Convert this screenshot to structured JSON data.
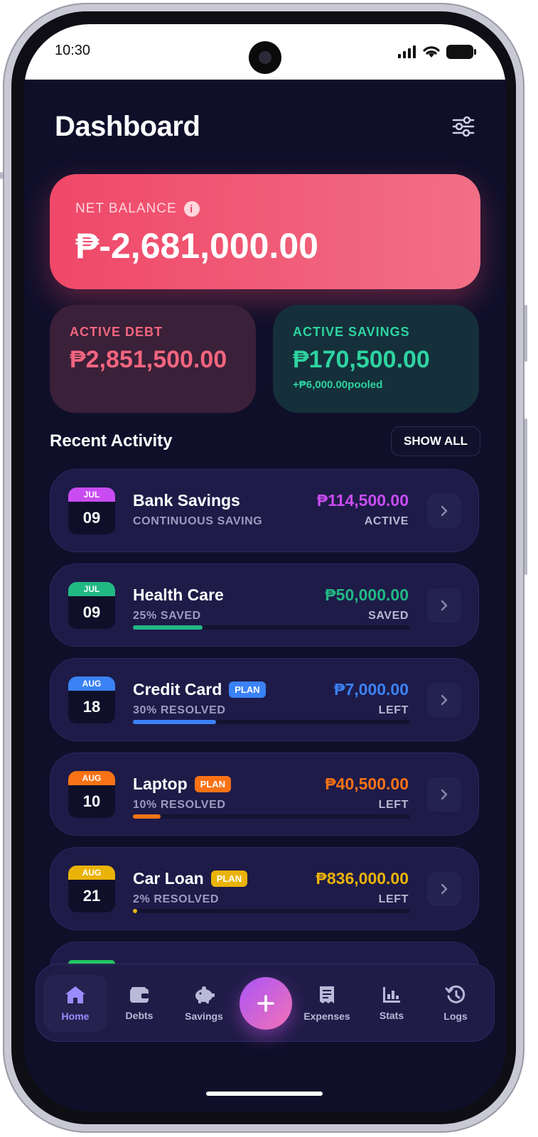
{
  "status_bar": {
    "time": "10:30"
  },
  "header": {
    "title": "Dashboard",
    "filter_icon": "sliders-icon"
  },
  "net_balance": {
    "label": "NET BALANCE",
    "value": "₱-2,681,000.00",
    "color": "#ef4868"
  },
  "summary": {
    "debt": {
      "label": "ACTIVE DEBT",
      "value": "₱2,851,500.00",
      "color": "#f2657f"
    },
    "savings": {
      "label": "ACTIVE SAVINGS",
      "value": "₱170,500.00",
      "sub": "+₱6,000.00pooled",
      "color": "#2ed3a0"
    }
  },
  "recent_activity": {
    "title": "Recent Activity",
    "show_all_label": "SHOW ALL",
    "items": [
      {
        "month": "JUL",
        "day": "09",
        "name": "Bank Savings",
        "badge": "",
        "subtitle": "CONTINUOUS SAVING",
        "amount": "₱114,500.00",
        "status": "ACTIVE",
        "color": "#c94cf2",
        "progress": null
      },
      {
        "month": "JUL",
        "day": "09",
        "name": "Health Care",
        "badge": "",
        "subtitle": "25% SAVED",
        "amount": "₱50,000.00",
        "status": "SAVED",
        "color": "#22b884",
        "progress": 0.25
      },
      {
        "month": "AUG",
        "day": "18",
        "name": "Credit Card",
        "badge": "PLAN",
        "subtitle": "30% RESOLVED",
        "amount": "₱7,000.00",
        "status": "LEFT",
        "color": "#3b82f6",
        "progress": 0.3
      },
      {
        "month": "AUG",
        "day": "10",
        "name": "Laptop",
        "badge": "PLAN",
        "subtitle": "10% RESOLVED",
        "amount": "₱40,500.00",
        "status": "LEFT",
        "color": "#f97316",
        "progress": 0.1
      },
      {
        "month": "AUG",
        "day": "21",
        "name": "Car Loan",
        "badge": "PLAN",
        "subtitle": "2% RESOLVED",
        "amount": "₱836,000.00",
        "status": "LEFT",
        "color": "#eab308",
        "progress": 0.02
      }
    ]
  },
  "bottom_nav": {
    "items": [
      {
        "label": "Home",
        "icon": "home-icon",
        "active": true
      },
      {
        "label": "Debts",
        "icon": "wallet-icon",
        "active": false
      },
      {
        "label": "Savings",
        "icon": "piggy-bank-icon",
        "active": false
      },
      {
        "label": "Expenses",
        "icon": "receipt-icon",
        "active": false
      },
      {
        "label": "Stats",
        "icon": "bar-chart-icon",
        "active": false
      },
      {
        "label": "Logs",
        "icon": "history-icon",
        "active": false
      }
    ],
    "fab_icon": "plus-icon"
  }
}
